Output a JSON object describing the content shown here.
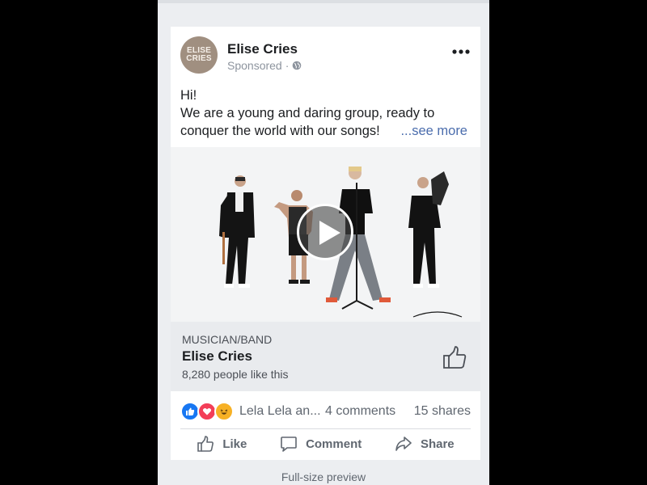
{
  "post": {
    "page_name": "Elise Cries",
    "avatar_text_line1": "ELISE",
    "avatar_text_line2": "CRIES",
    "sponsored": "Sponsored",
    "text_line1": "Hi!",
    "text_line2": "We are a young and daring group, ready to",
    "text_line3": "conquer the world with our songs!",
    "see_more": "...see more"
  },
  "cta": {
    "category": "MUSICIAN/BAND",
    "name": "Elise Cries",
    "likes": "8,280 people like this"
  },
  "engagement": {
    "reactors": "Lela Lela an...",
    "comments": "4 comments",
    "shares": "15 shares",
    "reaction_icons": [
      "like-icon",
      "love-icon",
      "haha-icon"
    ]
  },
  "actions": {
    "like": "Like",
    "comment": "Comment",
    "share": "Share"
  },
  "footer": "Full-size preview",
  "colors": {
    "like_blue": "#1877f2",
    "love_red": "#f33e58",
    "haha_yellow": "#f7b125",
    "see_more": "#4b6dad"
  }
}
